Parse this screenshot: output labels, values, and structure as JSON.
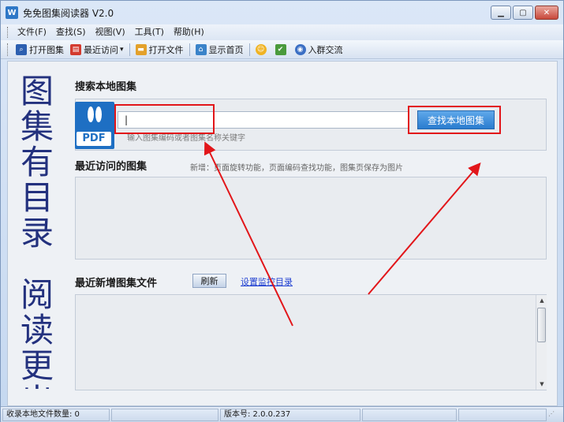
{
  "window": {
    "app_icon": "W",
    "title": "免免图集阅读器 V2.0",
    "buttons": {
      "minimize": "minimize-icon",
      "maximize": "maximize-icon",
      "close": "close-icon"
    }
  },
  "menu": {
    "items": [
      {
        "label": "文件(F)"
      },
      {
        "label": "查找(S)"
      },
      {
        "label": "视图(V)"
      },
      {
        "label": "工具(T)"
      },
      {
        "label": "帮助(H)"
      }
    ]
  },
  "toolbar": {
    "items": [
      {
        "label": "打开图集",
        "icon": "search-icon",
        "color": "#2c5fb0"
      },
      {
        "label": "最近访问",
        "icon": "recent-icon",
        "color": "#d33b2f",
        "dropdown": "▾"
      },
      {
        "label": "打开文件",
        "icon": "folder-icon",
        "color": "#e3a12b"
      },
      {
        "label": "显示首页",
        "icon": "home-icon",
        "color": "#3a83c9"
      }
    ],
    "extra_icons": [
      "emoji-icon",
      "check-icon"
    ],
    "group_label": "入群交流"
  },
  "side_slogan": {
    "top": [
      "图",
      "集",
      "有",
      "目",
      "录"
    ],
    "bottom": [
      "阅",
      "读",
      "更",
      "出"
    ]
  },
  "search": {
    "title": "搜索本地图集",
    "logo_label": "PDF",
    "input_value": "|",
    "hint": "输入图集编码或者图集名称关键字",
    "button_label": "查找本地图集"
  },
  "recent": {
    "title": "最近访问的图集",
    "note": "新增：页面旋转功能，页面编码查找功能，图集页保存为图片"
  },
  "new_files": {
    "title": "最近新增图集文件",
    "refresh_label": "刷新",
    "monitor_link": "设置监控目录"
  },
  "statusbar": {
    "file_count": "收录本地文件数量: 0",
    "version": "版本号: 2.0.0.237"
  },
  "annotations": {
    "highlight_color": "#e2161a"
  }
}
